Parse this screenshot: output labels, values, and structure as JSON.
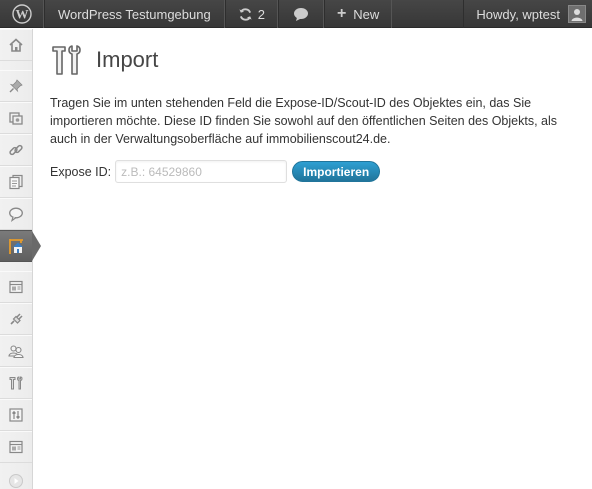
{
  "adminbar": {
    "site_name": "WordPress Testumgebung",
    "updates_count": "2",
    "new_label": "New",
    "account_label": "Howdy, wptest"
  },
  "sidebar": {
    "items": [
      {
        "icon": "dashboard-icon"
      },
      {
        "icon": "pin-icon"
      },
      {
        "icon": "media-icon"
      },
      {
        "icon": "link-icon"
      },
      {
        "icon": "pages-icon"
      },
      {
        "icon": "comments-icon"
      },
      {
        "icon": "immobilien-icon",
        "current": true
      },
      {
        "icon": "appearance-icon"
      },
      {
        "icon": "plugins-icon"
      },
      {
        "icon": "users-icon"
      },
      {
        "icon": "tools-icon"
      },
      {
        "icon": "settings-icon"
      },
      {
        "icon": "widget-icon"
      },
      {
        "icon": "collapse-icon"
      }
    ]
  },
  "page": {
    "title": "Import",
    "intro": "Tragen Sie im unten stehenden Feld die Expose-ID/Scout-ID des Objektes ein, das Sie importieren möchte. Diese ID finden Sie sowohl auf den öffentlichen Seiten des Objekts, als auch in der Verwaltungsoberfläche auf immobilienscout24.de.",
    "expose_label": "Expose ID:",
    "expose_placeholder": "z.B.: 64529860",
    "expose_value": "",
    "submit_label": "Importieren"
  },
  "colors": {
    "accent": "#21759b",
    "adminbar_bg": "#464646",
    "menu_bg": "#f1f1f1"
  }
}
